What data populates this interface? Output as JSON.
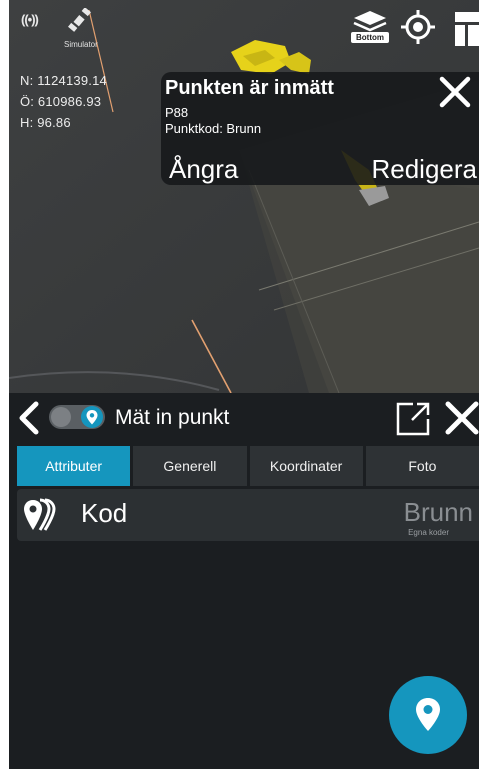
{
  "status": {
    "gps_icon": "gps-signal-icon",
    "satellite_icon": "satellite-icon",
    "simulator_label": "Simulator"
  },
  "coordinates": {
    "n": "N: 1124139.14",
    "o": "Ö: 610986.93",
    "h": "H: 96.86"
  },
  "map_tools": {
    "layers_tag": "Bottom",
    "layers_icon": "layers-icon",
    "target_icon": "crosshair-icon",
    "layout_icon": "layout-icon"
  },
  "toast": {
    "title": "Punkten är inmätt",
    "point_id": "P88",
    "point_code": "Punktkod: Brunn",
    "undo_label": "Ångra",
    "edit_label": "Redigera"
  },
  "panel": {
    "title": "Mät in punkt",
    "tabs": [
      "Attributer",
      "Generell",
      "Koordinater",
      "Foto"
    ],
    "active_tab": "Attributer",
    "code_row": {
      "label": "Kod",
      "value": "Brunn",
      "sub": "Egna koder"
    }
  },
  "colors": {
    "accent": "#1596be",
    "excavator": "#e6d21a",
    "background": "#1b1e21"
  }
}
